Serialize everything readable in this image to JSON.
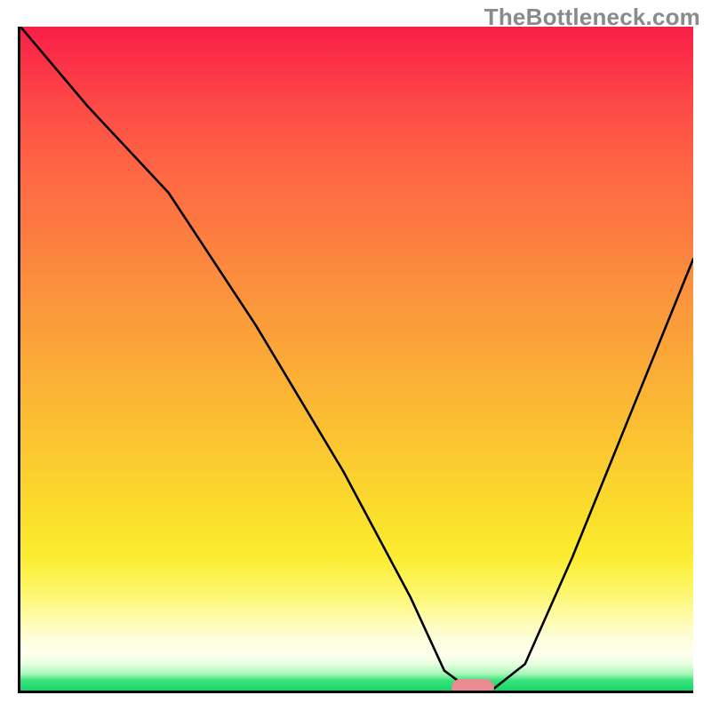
{
  "watermark": "TheBottleneck.com",
  "chart_data": {
    "type": "line",
    "title": "",
    "xlabel": "",
    "ylabel": "",
    "xlim": [
      0,
      100
    ],
    "ylim": [
      0,
      100
    ],
    "grid": false,
    "legend": false,
    "series": [
      {
        "name": "curve",
        "x": [
          0,
          10,
          22,
          35,
          48,
          58,
          63,
          67,
          70,
          75,
          82,
          90,
          100
        ],
        "values": [
          100,
          88,
          75,
          55,
          33,
          14,
          3,
          0,
          0,
          4,
          20,
          40,
          65
        ]
      }
    ],
    "marker": {
      "name": "optimum-marker",
      "x": 67,
      "y": 0.8,
      "color": "#e98b90"
    },
    "background_gradient": {
      "direction": "vertical",
      "stops": [
        {
          "pos": 0.0,
          "color": "#f91e47"
        },
        {
          "pos": 0.27,
          "color": "#fd7342"
        },
        {
          "pos": 0.59,
          "color": "#fbbd33"
        },
        {
          "pos": 0.85,
          "color": "#fdf669"
        },
        {
          "pos": 0.94,
          "color": "#feffee"
        },
        {
          "pos": 1.0,
          "color": "#14d66a"
        }
      ]
    }
  }
}
